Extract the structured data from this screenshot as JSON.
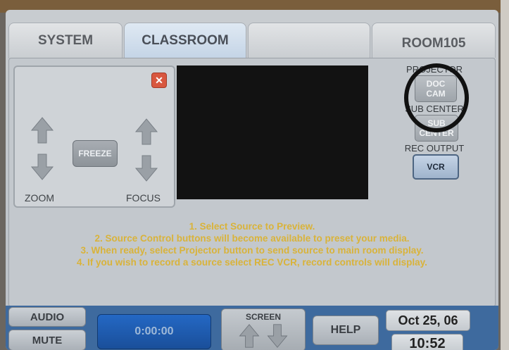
{
  "tabs": [
    {
      "label": "SYSTEM",
      "active": false
    },
    {
      "label": "CLASSROOM",
      "active": true
    },
    {
      "label": "",
      "active": false
    },
    {
      "label": "ROOM105",
      "active": false
    }
  ],
  "camera_controls": {
    "close_icon": "close-icon",
    "close_glyph": "✕",
    "freeze_label": "FREEZE",
    "zoom_label": "ZOOM",
    "focus_label": "FOCUS"
  },
  "sources": {
    "projector_label": "PROJECTOR",
    "doc_cam_label": "DOC CAM",
    "sub_center_label": "SUB CENTER",
    "sub_center_button": "SUB CENTER",
    "rec_output_label": "REC OUTPUT",
    "vcr_label": "VCR"
  },
  "instructions": [
    "1. Select Source to Preview.",
    "2. Source Control buttons will become available to preset your media.",
    "3. When ready, select Projector button to send source to main room display.",
    "4. If you wish to record a source select REC VCR, record controls will display."
  ],
  "bottom_bar": {
    "audio_label": "AUDIO",
    "mute_label": "MUTE",
    "timer_value": "0:00:00",
    "screen_label": "SCREEN",
    "help_label": "HELP",
    "date": "Oct 25, 06",
    "time": "10:52"
  },
  "colors": {
    "instruction_text": "#d9b33a",
    "bottom_bar": "#3e6a9e",
    "timer": "#2468c4",
    "close_button": "#d8573f"
  }
}
